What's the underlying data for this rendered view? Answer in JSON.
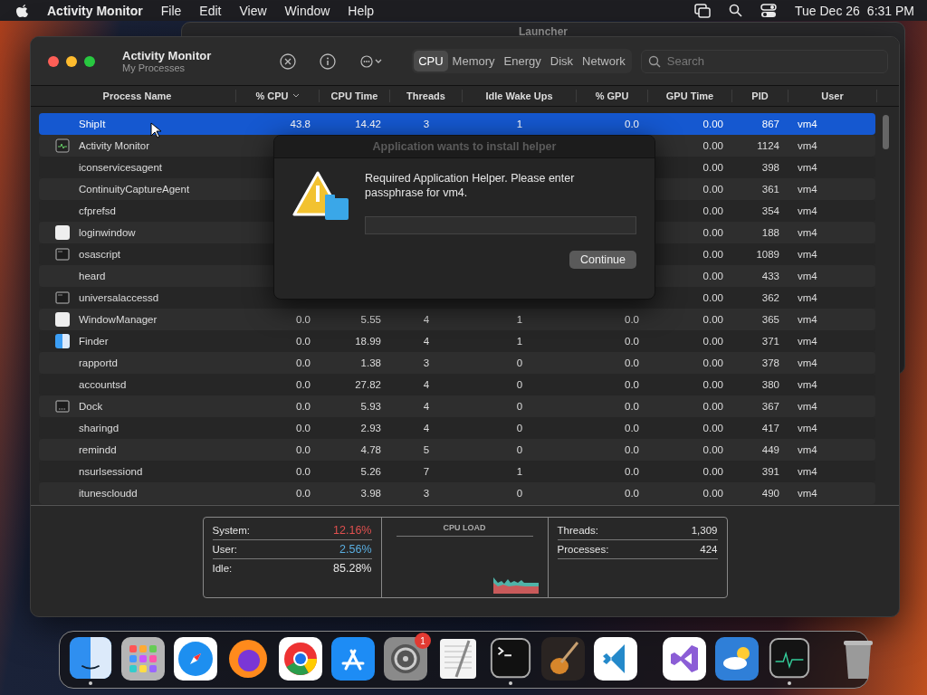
{
  "menu_bar": {
    "app": "Activity Monitor",
    "menus": [
      "File",
      "Edit",
      "View",
      "Window",
      "Help"
    ],
    "date": "Tue Dec 26",
    "time": "6:31 PM"
  },
  "background_window": {
    "title": "Launcher"
  },
  "window": {
    "title": "Activity Monitor",
    "subtitle": "My Processes",
    "tabs": [
      {
        "label": "CPU",
        "selected": true
      },
      {
        "label": "Memory",
        "selected": false
      },
      {
        "label": "Energy",
        "selected": false
      },
      {
        "label": "Disk",
        "selected": false
      },
      {
        "label": "Network",
        "selected": false
      }
    ],
    "search": {
      "placeholder": "Search"
    },
    "table": {
      "columns": [
        {
          "label": "Process Name",
          "sorted": false
        },
        {
          "label": "% CPU",
          "sorted": true
        },
        {
          "label": "CPU Time",
          "sorted": false
        },
        {
          "label": "Threads",
          "sorted": false
        },
        {
          "label": "Idle Wake Ups",
          "sorted": false
        },
        {
          "label": "% GPU",
          "sorted": false
        },
        {
          "label": "GPU Time",
          "sorted": false
        },
        {
          "label": "PID",
          "sorted": false
        },
        {
          "label": "User",
          "sorted": false
        }
      ],
      "rows": [
        {
          "name": "ShipIt",
          "selected": true,
          "values": [
            "43.8",
            "14.42",
            "3",
            "1",
            "0.0",
            "0.00",
            "867",
            "vm4"
          ]
        },
        {
          "name": "Activity Monitor",
          "kind": "monitor",
          "selected": false,
          "values": [
            "0.00",
            "1124",
            "vm4"
          ]
        },
        {
          "name": "iconservicesagent",
          "selected": false,
          "values": [
            "0.00",
            "398",
            "vm4"
          ]
        },
        {
          "name": "ContinuityCaptureAgent",
          "selected": false,
          "values": [
            "0.00",
            "361",
            "vm4"
          ]
        },
        {
          "name": "cfprefsd",
          "selected": false,
          "values": [
            "0.00",
            "354",
            "vm4"
          ]
        },
        {
          "name": "loginwindow",
          "kind": "plain",
          "selected": false,
          "values": [
            "0.00",
            "188",
            "vm4"
          ]
        },
        {
          "name": "osascript",
          "kind": "window",
          "selected": false,
          "values": [
            "0.00",
            "1089",
            "vm4"
          ]
        },
        {
          "name": "heard",
          "selected": false,
          "values": [
            "0.00",
            "433",
            "vm4"
          ]
        },
        {
          "name": "universalaccessd",
          "kind": "window",
          "selected": false,
          "values": [
            "0.00",
            "362",
            "vm4"
          ]
        },
        {
          "name": "WindowManager",
          "kind": "plain",
          "selected": false,
          "values": [
            "0.0",
            "5.55",
            "4",
            "1",
            "0.0",
            "0.00",
            "365",
            "vm4"
          ]
        },
        {
          "name": "Finder",
          "kind": "finder",
          "selected": false,
          "values": [
            "0.0",
            "18.99",
            "4",
            "1",
            "0.0",
            "0.00",
            "371",
            "vm4"
          ]
        },
        {
          "name": "rapportd",
          "selected": false,
          "values": [
            "0.0",
            "1.38",
            "3",
            "0",
            "0.0",
            "0.00",
            "378",
            "vm4"
          ]
        },
        {
          "name": "accountsd",
          "selected": false,
          "values": [
            "0.0",
            "27.82",
            "4",
            "0",
            "0.0",
            "0.00",
            "380",
            "vm4"
          ]
        },
        {
          "name": "Dock",
          "kind": "dock",
          "selected": false,
          "values": [
            "0.0",
            "5.93",
            "4",
            "0",
            "0.0",
            "0.00",
            "367",
            "vm4"
          ]
        },
        {
          "name": "sharingd",
          "selected": false,
          "values": [
            "0.0",
            "2.93",
            "4",
            "0",
            "0.0",
            "0.00",
            "417",
            "vm4"
          ]
        },
        {
          "name": "remindd",
          "selected": false,
          "values": [
            "0.0",
            "4.78",
            "5",
            "0",
            "0.0",
            "0.00",
            "449",
            "vm4"
          ]
        },
        {
          "name": "nsurlsessiond",
          "selected": false,
          "values": [
            "0.0",
            "5.26",
            "7",
            "1",
            "0.0",
            "0.00",
            "391",
            "vm4"
          ]
        },
        {
          "name": "itunescloudd",
          "selected": false,
          "values": [
            "0.0",
            "3.98",
            "3",
            "0",
            "0.0",
            "0.00",
            "490",
            "vm4"
          ]
        }
      ]
    },
    "stats": {
      "load": [
        {
          "label": "System:",
          "value": "12.16%",
          "color": "#e0504f"
        },
        {
          "label": "User:",
          "value": "2.56%",
          "color": "#5aaee0"
        },
        {
          "label": "Idle:",
          "value": "85.28%",
          "color": "#e6e6e6"
        }
      ],
      "chart_title": "CPU LOAD",
      "totals": [
        {
          "label": "Threads:",
          "value": "1,309"
        },
        {
          "label": "Processes:",
          "value": "424"
        }
      ]
    }
  },
  "dialog": {
    "title": "Application wants to install helper",
    "message": "Required Application Helper. Please enter passphrase for vm4.",
    "button": "Continue"
  },
  "dock": {
    "apps": [
      {
        "kind": "finder",
        "running": true
      },
      {
        "kind": "launchpad",
        "running": false
      },
      {
        "kind": "safari",
        "running": false
      },
      {
        "kind": "firefox",
        "running": false
      },
      {
        "kind": "chrome",
        "running": false
      },
      {
        "kind": "appstore",
        "running": false
      },
      {
        "kind": "settings",
        "running": false,
        "badge": "1"
      },
      {
        "kind": "textedit",
        "running": false
      },
      {
        "kind": "terminal",
        "running": true
      },
      {
        "kind": "guitar",
        "running": false
      },
      {
        "kind": "vscode",
        "running": false
      }
    ],
    "recent": [
      {
        "kind": "visualstudio",
        "running": false
      },
      {
        "kind": "weather",
        "running": false
      },
      {
        "kind": "monitor",
        "running": true
      }
    ],
    "trash": [
      {
        "kind": "trash",
        "running": false
      }
    ]
  }
}
